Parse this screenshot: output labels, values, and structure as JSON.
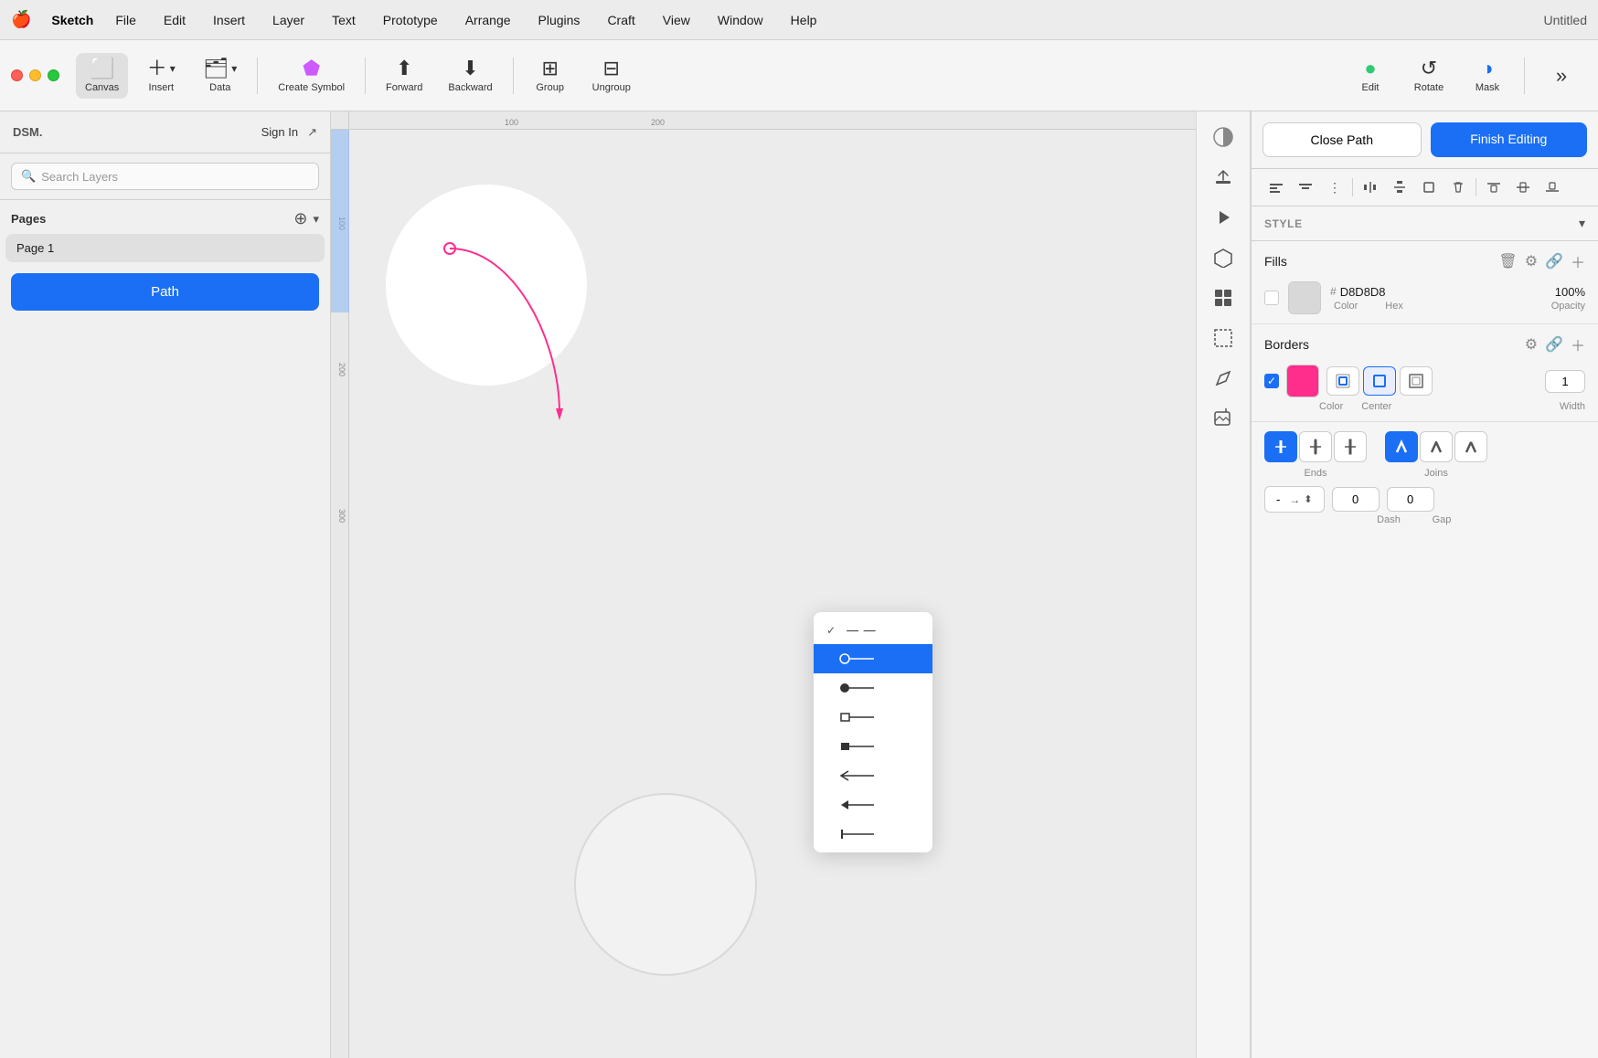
{
  "app": {
    "title": "Untitled",
    "name": "Sketch"
  },
  "menubar": {
    "apple": "🍎",
    "items": [
      "File",
      "Edit",
      "Insert",
      "Layer",
      "Text",
      "Prototype",
      "Arrange",
      "Plugins",
      "Craft",
      "View",
      "Window",
      "Help"
    ]
  },
  "toolbar": {
    "canvas_label": "Canvas",
    "insert_label": "Insert",
    "data_label": "Data",
    "create_symbol_label": "Create Symbol",
    "forward_label": "Forward",
    "backward_label": "Backward",
    "group_label": "Group",
    "ungroup_label": "Ungroup",
    "edit_label": "Edit",
    "rotate_label": "Rotate",
    "mask_label": "Mask"
  },
  "sidebar_left": {
    "dsm_label": "DSM.",
    "sign_in_label": "Sign In",
    "search_placeholder": "Search Layers",
    "pages_label": "Pages",
    "pages": [
      {
        "name": "Page 1"
      }
    ],
    "layers": [
      {
        "name": "Path",
        "active": true
      }
    ]
  },
  "inspector": {
    "close_path_label": "Close Path",
    "finish_editing_label": "Finish Editing",
    "style_label": "STYLE",
    "fills_label": "Fills",
    "borders_label": "Borders",
    "fill_color_hex": "D8D8D8",
    "fill_opacity": "100%",
    "fill_color_label": "Color",
    "fill_hex_label": "Hex",
    "fill_opacity_label": "Opacity",
    "border_color": "#FF2D8C",
    "border_type": "Center",
    "border_width": "1",
    "border_color_label": "Color",
    "border_center_label": "Center",
    "border_width_label": "Width",
    "ends_label": "Ends",
    "joins_label": "Joins",
    "dash_value": "-",
    "dash_label": "Dash",
    "gap_value": "0",
    "gap_label": "Gap",
    "dash_num": "0",
    "gap_num": "0"
  },
  "dropdown": {
    "items": [
      {
        "icon": "—",
        "label": "",
        "check": true
      },
      {
        "icon": "○—",
        "label": "",
        "selected": true
      },
      {
        "icon": "●—",
        "label": ""
      },
      {
        "icon": "□—",
        "label": ""
      },
      {
        "icon": "■—",
        "label": ""
      },
      {
        "icon": "←",
        "label": ""
      },
      {
        "icon": "◀",
        "label": ""
      },
      {
        "icon": "├",
        "label": ""
      }
    ]
  },
  "ruler": {
    "marks_top": [
      "100",
      "200"
    ],
    "marks_left": [
      "100",
      "200",
      "300"
    ]
  }
}
